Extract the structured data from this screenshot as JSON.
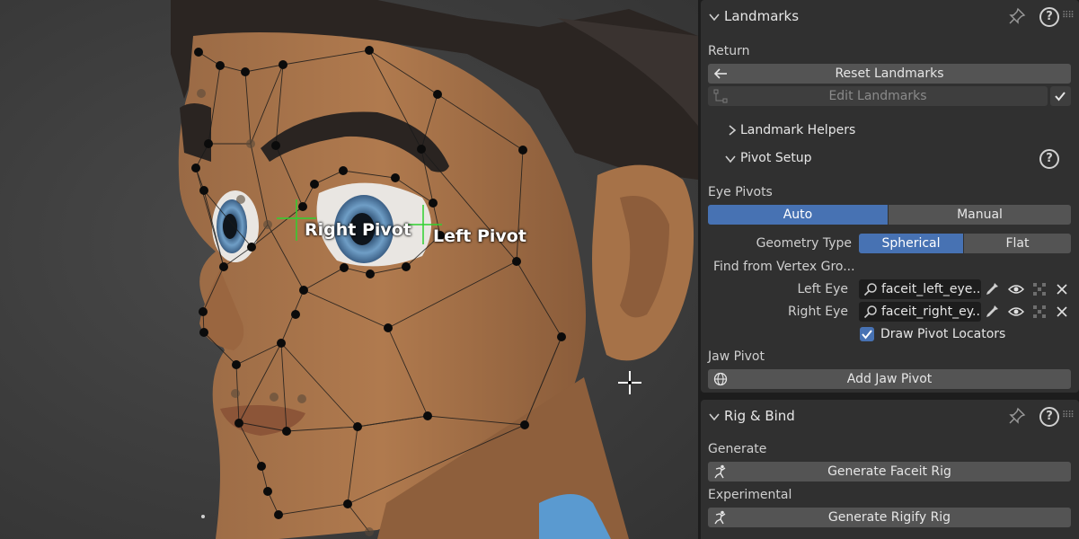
{
  "viewport": {
    "right_pivot_label": "Right Pivot",
    "left_pivot_label": "Left Pivot"
  },
  "landmarks_panel": {
    "title": "Landmarks",
    "return_label": "Return",
    "reset_button": "Reset Landmarks",
    "edit_button": "Edit Landmarks",
    "helpers_label": "Landmark Helpers",
    "pivot_setup_label": "Pivot Setup",
    "eye_pivots_label": "Eye Pivots",
    "eye_pivot_modes": [
      "Auto",
      "Manual"
    ],
    "eye_pivot_selected": "Auto",
    "geometry_type_label": "Geometry Type",
    "geometry_types": [
      "Spherical",
      "Flat"
    ],
    "geometry_selected": "Spherical",
    "find_vertex_label": "Find from Vertex Gro...",
    "left_eye_label": "Left Eye",
    "left_eye_value": "faceit_left_eye...",
    "right_eye_label": "Right Eye",
    "right_eye_value": "faceit_right_ey...",
    "draw_pivot_label": "Draw Pivot Locators",
    "draw_pivot_checked": true,
    "jaw_pivot_label": "Jaw Pivot",
    "add_jaw_button": "Add Jaw Pivot"
  },
  "rig_panel": {
    "title": "Rig & Bind",
    "generate_label": "Generate",
    "generate_faceit_button": "Generate Faceit Rig",
    "experimental_label": "Experimental",
    "generate_rigify_button": "Generate Rigify Rig"
  },
  "colors": {
    "accent": "#4772b3",
    "panel_bg": "#303030",
    "button_bg": "#545454"
  },
  "icons": {
    "collapse": "chevron-down-icon",
    "expand": "chevron-right-icon",
    "pin": "pin-icon",
    "help": "help-icon",
    "back": "arrow-left-icon",
    "search": "search-icon",
    "eyedropper": "eyedropper-icon",
    "visibility": "eye-icon",
    "clear": "close-icon",
    "rig": "armature-icon"
  }
}
